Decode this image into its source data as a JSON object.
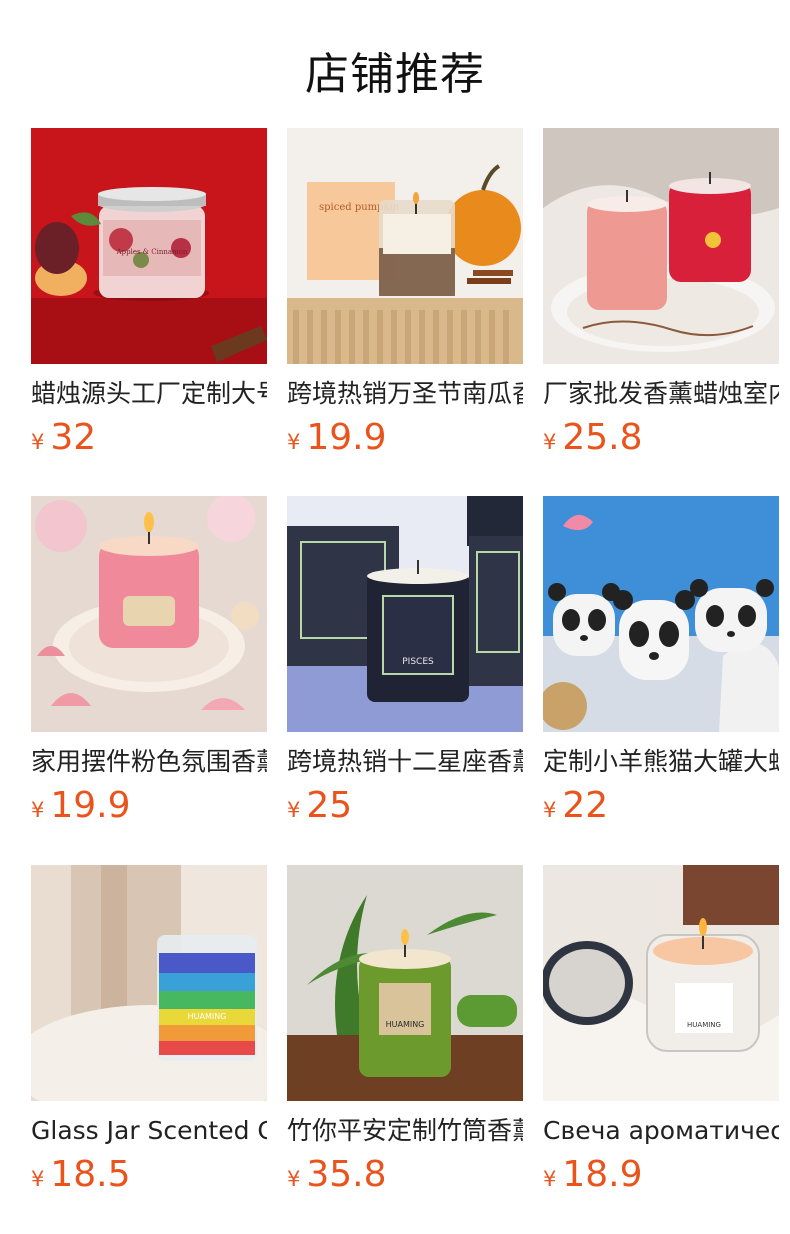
{
  "header": {
    "title": "店铺推荐"
  },
  "products": [
    {
      "name": "蜡烛源头工厂定制大号",
      "currency": "¥",
      "price": "32",
      "image": "candle-red-tin-icon",
      "label": "Apples & Cinnamon"
    },
    {
      "name": "跨境热销万圣节南瓜香",
      "currency": "¥",
      "price": "19.9",
      "image": "pumpkin-candle-icon",
      "label": "spiced pumpkin"
    },
    {
      "name": "厂家批发香薰蜡烛室内",
      "currency": "¥",
      "price": "25.8",
      "image": "pink-red-candles-icon",
      "label": ""
    },
    {
      "name": "家用摆件粉色氛围香薰",
      "currency": "¥",
      "price": "19.9",
      "image": "pink-shell-candle-icon",
      "label": ""
    },
    {
      "name": "跨境热销十二星座香薰",
      "currency": "¥",
      "price": "25",
      "image": "zodiac-candle-icon",
      "label": "PISCES"
    },
    {
      "name": "定制小羊熊猫大罐大蜡",
      "currency": "¥",
      "price": "22",
      "image": "panda-cups-icon",
      "label": ""
    },
    {
      "name": "Glass Jar Scented Candle",
      "currency": "¥",
      "price": "18.5",
      "image": "rainbow-candle-icon",
      "label": "HUAMING"
    },
    {
      "name": "竹你平安定制竹筒香薰",
      "currency": "¥",
      "price": "35.8",
      "image": "bamboo-candle-icon",
      "label": "HUAMING"
    },
    {
      "name": "Свеча ароматическая",
      "currency": "¥",
      "price": "18.9",
      "image": "glass-jar-candle-icon",
      "label": "HUAMING"
    }
  ]
}
